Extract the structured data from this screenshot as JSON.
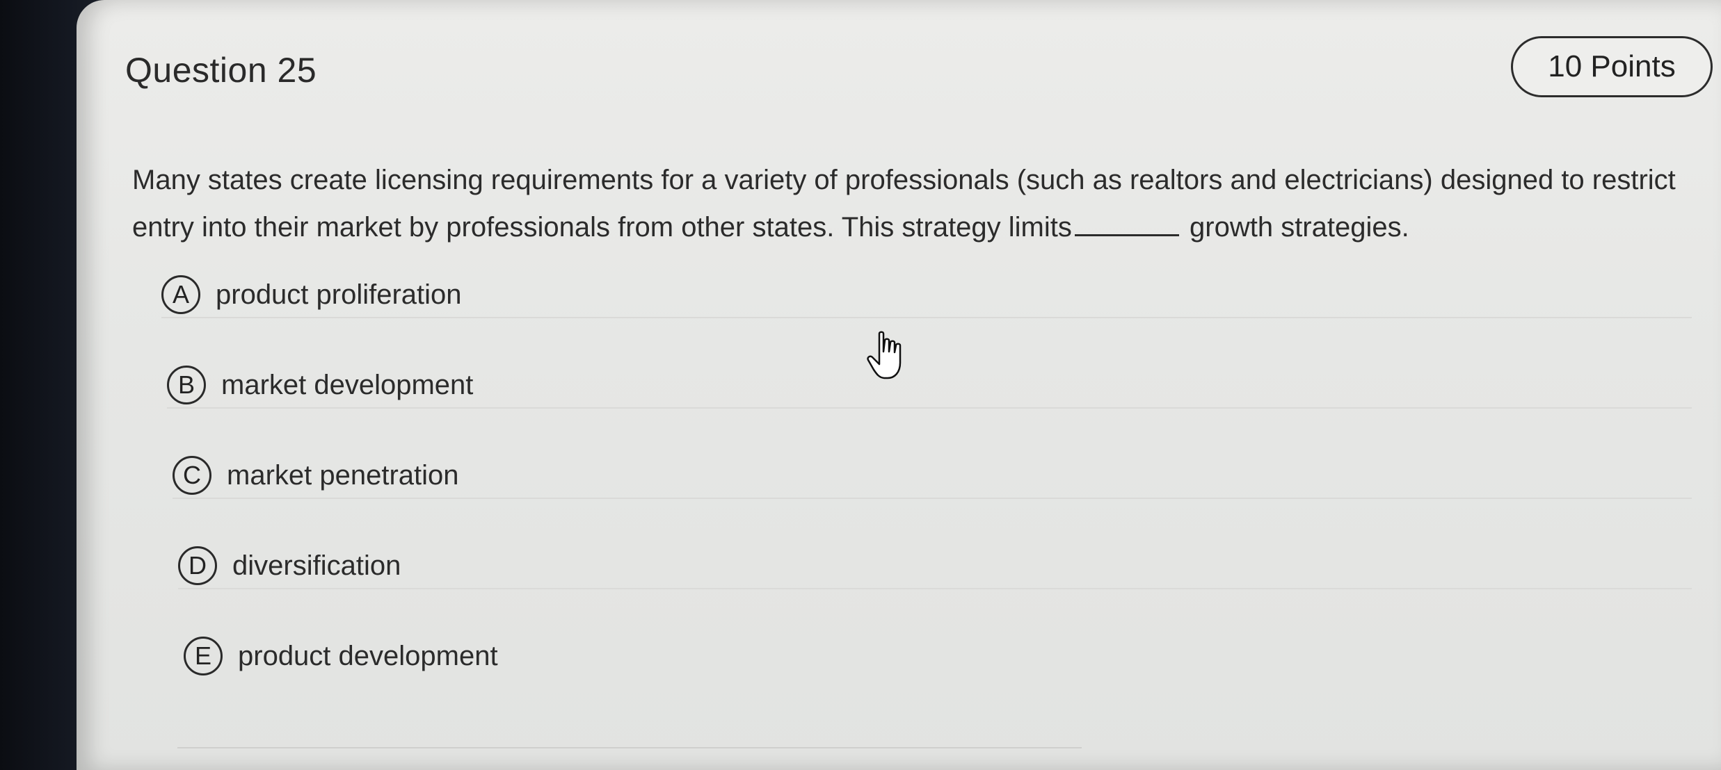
{
  "question": {
    "title": "Question 25",
    "points": "10 Points",
    "text_before": "Many states create licensing requirements for a variety of professionals (such as realtors and electricians) designed to restrict entry into their market by professionals from other states. This strategy limits",
    "text_after": "growth strategies."
  },
  "options": [
    {
      "letter": "A",
      "label": "product proliferation"
    },
    {
      "letter": "B",
      "label": "market development"
    },
    {
      "letter": "C",
      "label": "market penetration"
    },
    {
      "letter": "D",
      "label": "diversification"
    },
    {
      "letter": "E",
      "label": "product development"
    }
  ],
  "cursor": {
    "icon": "hand-pointer-icon"
  }
}
